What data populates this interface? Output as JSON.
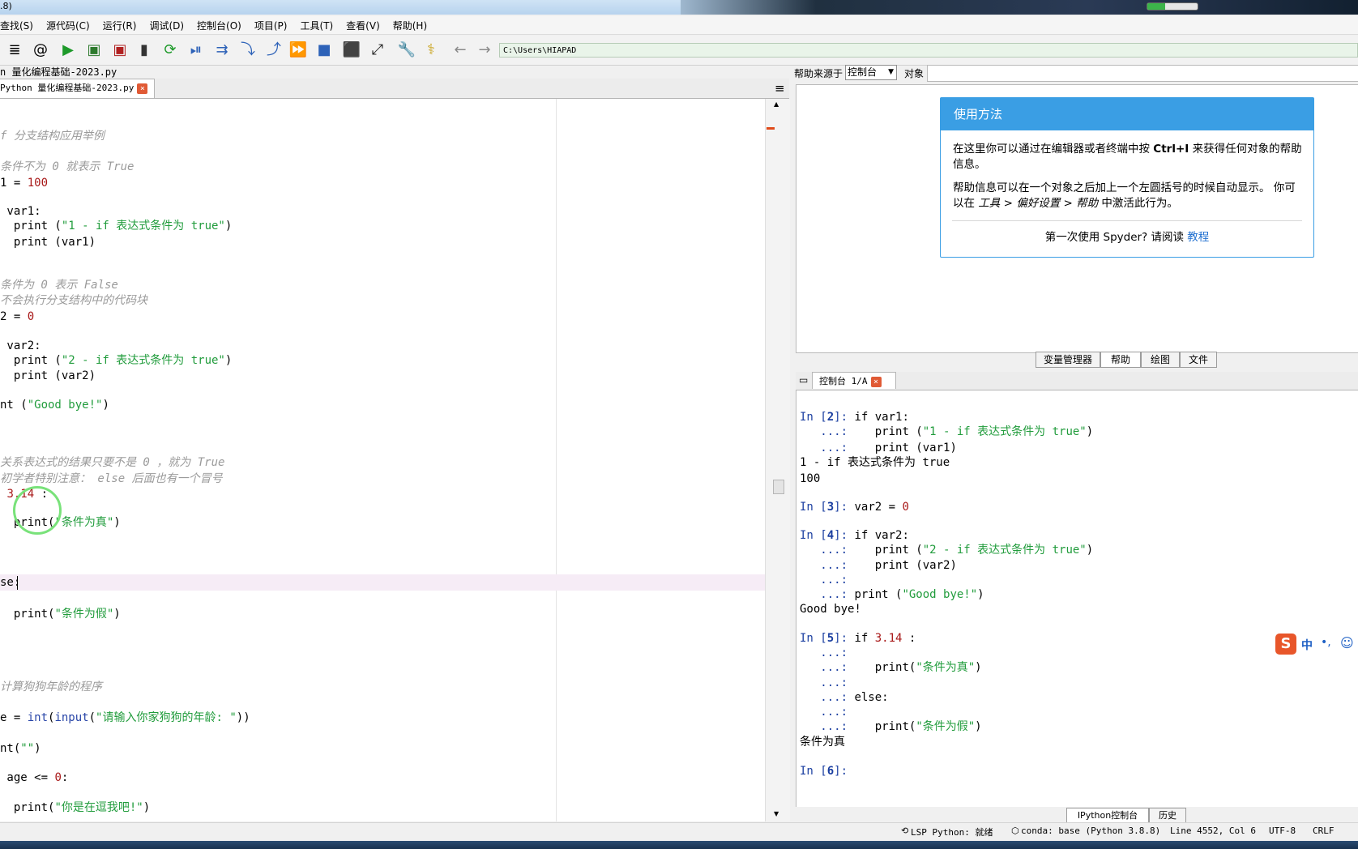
{
  "titlebar": {
    "text": ".8)"
  },
  "menubar": {
    "items": [
      "查找(S)",
      "源代码(C)",
      "运行(R)",
      "调试(D)",
      "控制台(O)",
      "项目(P)",
      "工具(T)",
      "查看(V)",
      "帮助(H)"
    ]
  },
  "toolbar": {
    "path": "C:\\Users\\HIAPAD",
    "progress": 0.35,
    "icons": {
      "list": "≣",
      "email": "@",
      "run": "▶",
      "run_cell": "▣",
      "run_cell_advance": "▣",
      "run_selection": "▮",
      "rerun": "⟳",
      "debug": "⏯",
      "step": "⇉",
      "step_into": "⤵",
      "step_return": "⤴",
      "continue": "⏩",
      "stop": "■",
      "maximize_pane": "⬛",
      "fullscreen": "⤢",
      "preferences": "🔧",
      "python_path": "⚕",
      "back": "←",
      "forward": "→"
    }
  },
  "editor": {
    "file_path": "n 量化编程基础-2023.py",
    "tab_label": "Python 量化编程基础-2023.py",
    "close_glyph": "×",
    "burger": "≡",
    "lines": {
      "l1": "f 分支结构应用举例",
      "l2": "条件不为 0 就表示 True",
      "l3a": "1 = ",
      "l3b": "100",
      "l4": " var1:",
      "l5a": "  print (",
      "l5b": "\"1 - if 表达式条件为 true\"",
      "l5c": ")",
      "l6": "  print (var1)",
      "l7": "条件为 0 表示 False",
      "l8": "不会执行分支结构中的代码块",
      "l9a": "2 = ",
      "l9b": "0",
      "l10": " var2:",
      "l11a": "  print (",
      "l11b": "\"2 - if 表达式条件为 true\"",
      "l11c": ")",
      "l12": "  print (var2)",
      "l13a": "nt (",
      "l13b": "\"Good bye!\"",
      "l13c": ")",
      "l14": "关系表达式的结果只要不是 0 ，就为 True",
      "l15": "初学者特别注意： else 后面也有一个冒号",
      "l16a": " ",
      "l16b": "3.14",
      "l16c": " :",
      "l17a": "  print(",
      "l17b": "\"条件为真\"",
      "l17c": ")",
      "l18": "se:",
      "l19a": "  print(",
      "l19b": "\"条件为假\"",
      "l19c": ")",
      "l20": "计算狗狗年龄的程序",
      "l21a": "e = ",
      "l21b": "int",
      "l21c": "(",
      "l21d": "input",
      "l21e": "(",
      "l21f": "\"请输入你家狗狗的年龄: \"",
      "l21g": "))",
      "l22a": "nt(",
      "l22b": "\"\"",
      "l22c": ")",
      "l23a": " age <= ",
      "l23b": "0",
      "l23c": ":",
      "l24a": "  print(",
      "l24b": "\"你是在逗我吧!\"",
      "l24c": ")"
    }
  },
  "help": {
    "source_label": "帮助来源于",
    "source_value": "控制台",
    "object_label": "对象",
    "card_title": "使用方法",
    "p1a": "在这里你可以通过在编辑器或者终端中按 ",
    "p1b": "Ctrl+I",
    "p1c": " 来获得任何对象的帮助信息。",
    "p2a": "帮助信息可以在一个对象之后加上一个左圆括号的时候自动显示。 你可以在 ",
    "p2b": "工具 > 偏好设置 > 帮助",
    "p2c": " 中激活此行为。",
    "p3a": "第一次使用 Spyder? 请阅读 ",
    "p3b": "教程",
    "pane_tabs": [
      "变量管理器",
      "帮助",
      "绘图",
      "文件"
    ]
  },
  "console": {
    "tab_label": "控制台 1/A",
    "close_glyph": "×",
    "cont": "...:",
    "in": "In ",
    "lines": {
      "n2": "2",
      "c2": " if var1:",
      "c2b1": "    print (",
      "c2b2": "\"1 - if 表达式条件为 true\"",
      "c2b3": ")",
      "c2c": "    print (var1)",
      "o2a": "1 - if 表达式条件为 true",
      "o2b": "100",
      "n3": "3",
      "c3a": " var2 = ",
      "c3b": "0",
      "n4": "4",
      "c4": " if var2:",
      "c4b1": "    print (",
      "c4b2": "\"2 - if 表达式条件为 true\"",
      "c4b3": ")",
      "c4c": "    print (var2)",
      "c4e1": " print (",
      "c4e2": "\"Good bye!\"",
      "c4e3": ")",
      "o4": "Good bye!",
      "n5": "5",
      "c5a": " if ",
      "c5b": "3.14",
      "c5c": " :",
      "c5e1": "    print(",
      "c5e2": "\"条件为真\"",
      "c5e3": ")",
      "c5g": " else:",
      "c5i1": "    print(",
      "c5i2": "\"条件为假\"",
      "c5i3": ")",
      "o5": "条件为真",
      "n6": "6"
    },
    "bottom_tabs": [
      "IPython控制台",
      "历史"
    ]
  },
  "ime": {
    "logo": "S",
    "mode": "中",
    "punct": "•,",
    "emoji": "☺"
  },
  "statusbar": {
    "lsp": "LSP Python: 就绪",
    "conda": "conda: base (Python 3.8.8)",
    "position": "Line 4552, Col 6",
    "encoding": "UTF-8",
    "eol": "CRLF"
  }
}
